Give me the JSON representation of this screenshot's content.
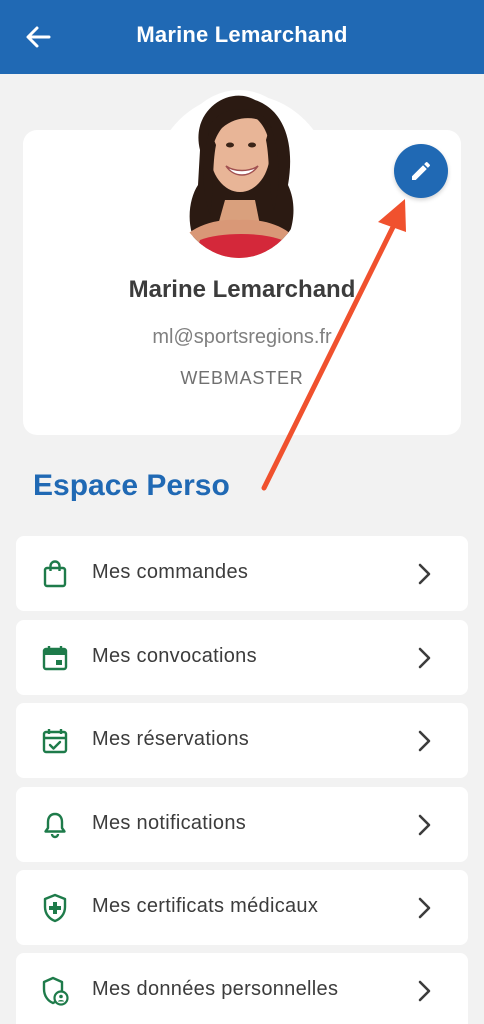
{
  "header": {
    "title": "Marine Lemarchand"
  },
  "profile": {
    "name": "Marine Lemarchand",
    "email": "ml@sportsregions.fr",
    "role": "WEBMASTER"
  },
  "section": {
    "title": "Espace Perso"
  },
  "menu": [
    {
      "label": "Mes commandes",
      "icon": "shopping-bag-icon"
    },
    {
      "label": "Mes convocations",
      "icon": "calendar-event-icon"
    },
    {
      "label": "Mes réservations",
      "icon": "calendar-check-icon"
    },
    {
      "label": "Mes notifications",
      "icon": "bell-icon"
    },
    {
      "label": "Mes certificats médicaux",
      "icon": "medical-shield-icon"
    },
    {
      "label": "Mes données personnelles",
      "icon": "privacy-shield-icon"
    }
  ],
  "colors": {
    "primary": "#2069b4",
    "icon_green": "#1e7b4a",
    "annotation_arrow": "#f0512e",
    "background": "#f2f2f2"
  }
}
